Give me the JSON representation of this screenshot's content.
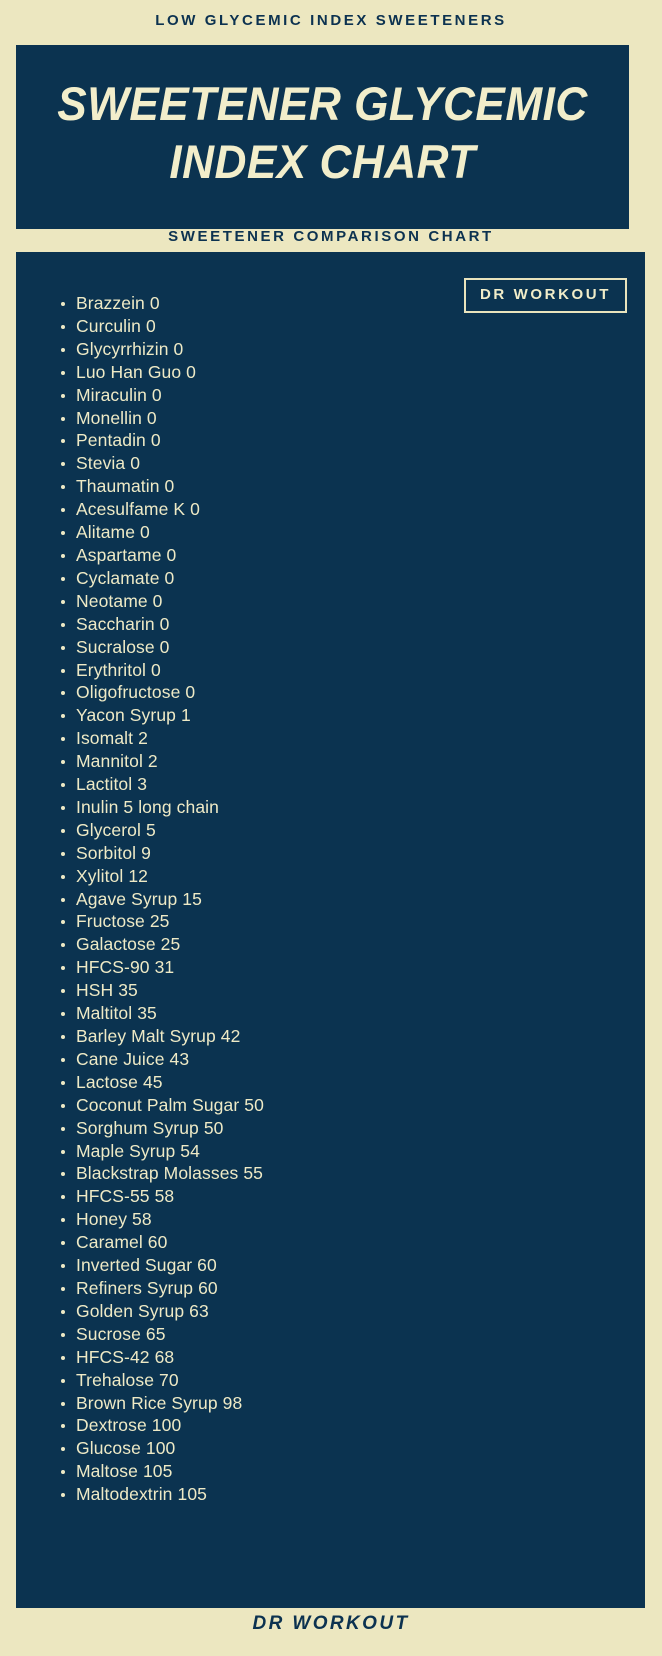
{
  "colors": {
    "background": "#ece7c0",
    "panel": "#0b3350",
    "panel_text": "#eeeac6",
    "heading_text": "#0c3250",
    "badge_border": "#e9e4bd"
  },
  "header": {
    "eyebrow": "LOW GLYCEMIC INDEX SWEETENERS",
    "title": "SWEETENER GLYCEMIC INDEX CHART",
    "subheading": "SWEETENER COMPARISON CHART"
  },
  "badge": {
    "label": "DR WORKOUT"
  },
  "footer": {
    "label": "DR WORKOUT"
  },
  "chart_data": {
    "type": "table",
    "title": "SWEETENER GLYCEMIC INDEX CHART",
    "subtitle": "SWEETENER COMPARISON CHART",
    "xlabel": "",
    "ylabel": "Glycemic Index",
    "categories": [
      "Brazzein",
      "Curculin",
      "Glycyrrhizin",
      "Luo Han Guo",
      "Miraculin",
      "Monellin",
      "Pentadin",
      "Stevia",
      "Thaumatin",
      "Acesulfame K",
      "Alitame",
      "Aspartame",
      "Cyclamate",
      "Neotame",
      "Saccharin",
      "Sucralose",
      "Erythritol",
      "Oligofructose",
      "Yacon Syrup",
      "Isomalt",
      "Mannitol",
      "Lactitol",
      "Inulin",
      "Glycerol",
      "Sorbitol",
      "Xylitol",
      "Agave Syrup",
      "Fructose",
      "Galactose",
      "HFCS-90",
      "HSH",
      "Maltitol",
      "Barley Malt Syrup",
      "Cane Juice",
      "Lactose",
      "Coconut Palm Sugar",
      "Sorghum Syrup",
      "Maple Syrup",
      "Blackstrap Molasses",
      "HFCS-55",
      "Honey",
      "Caramel",
      "Inverted Sugar",
      "Refiners Syrup",
      "Golden Syrup",
      "Sucrose",
      "HFCS-42",
      "Trehalose",
      "Brown Rice Syrup",
      "Dextrose",
      "Glucose",
      "Maltose",
      "Maltodextrin"
    ],
    "values": [
      0,
      0,
      0,
      0,
      0,
      0,
      0,
      0,
      0,
      0,
      0,
      0,
      0,
      0,
      0,
      0,
      0,
      0,
      1,
      2,
      2,
      3,
      5,
      5,
      9,
      12,
      15,
      25,
      25,
      31,
      35,
      35,
      42,
      43,
      45,
      50,
      50,
      54,
      55,
      58,
      58,
      60,
      60,
      60,
      63,
      65,
      68,
      70,
      98,
      100,
      100,
      105,
      105
    ],
    "ylim": [
      0,
      105
    ]
  },
  "list": {
    "items": [
      {
        "text": "Brazzein 0"
      },
      {
        "text": "Curculin 0"
      },
      {
        "text": "Glycyrrhizin 0"
      },
      {
        "text": "Luo Han Guo 0"
      },
      {
        "text": "Miraculin 0"
      },
      {
        "text": "Monellin 0"
      },
      {
        "text": "Pentadin 0"
      },
      {
        "text": "Stevia 0"
      },
      {
        "text": "Thaumatin 0"
      },
      {
        "text": "Acesulfame K 0"
      },
      {
        "text": "Alitame 0"
      },
      {
        "text": "Aspartame 0"
      },
      {
        "text": "Cyclamate 0"
      },
      {
        "text": "Neotame 0"
      },
      {
        "text": "Saccharin 0"
      },
      {
        "text": "Sucralose 0"
      },
      {
        "text": "Erythritol 0"
      },
      {
        "text": "Oligofructose 0"
      },
      {
        "text": "Yacon Syrup 1"
      },
      {
        "text": "Isomalt 2"
      },
      {
        "text": "Mannitol 2"
      },
      {
        "text": "Lactitol 3"
      },
      {
        "text": "Inulin 5 long chain"
      },
      {
        "text": "Glycerol 5"
      },
      {
        "text": "Sorbitol 9"
      },
      {
        "text": "Xylitol 12"
      },
      {
        "text": "Agave Syrup 15"
      },
      {
        "text": "Fructose 25"
      },
      {
        "text": "Galactose 25"
      },
      {
        "text": "HFCS-90 31"
      },
      {
        "text": "HSH 35"
      },
      {
        "text": "Maltitol 35"
      },
      {
        "text": "Barley Malt Syrup 42"
      },
      {
        "text": "Cane Juice 43"
      },
      {
        "text": "Lactose 45"
      },
      {
        "text": "Coconut Palm Sugar 50"
      },
      {
        "text": "Sorghum Syrup 50"
      },
      {
        "text": "Maple Syrup 54"
      },
      {
        "text": "Blackstrap Molasses 55"
      },
      {
        "text": "HFCS-55 58"
      },
      {
        "text": "Honey 58"
      },
      {
        "text": "Caramel 60"
      },
      {
        "text": "Inverted Sugar 60"
      },
      {
        "text": "Refiners Syrup 60"
      },
      {
        "text": "Golden Syrup 63"
      },
      {
        "text": "Sucrose 65"
      },
      {
        "text": "HFCS-42 68"
      },
      {
        "text": "Trehalose 70"
      },
      {
        "text": "Brown Rice Syrup 98"
      },
      {
        "text": "Dextrose 100"
      },
      {
        "text": "Glucose 100"
      },
      {
        "text": "Maltose 105"
      },
      {
        "text": "Maltodextrin 105"
      }
    ]
  }
}
